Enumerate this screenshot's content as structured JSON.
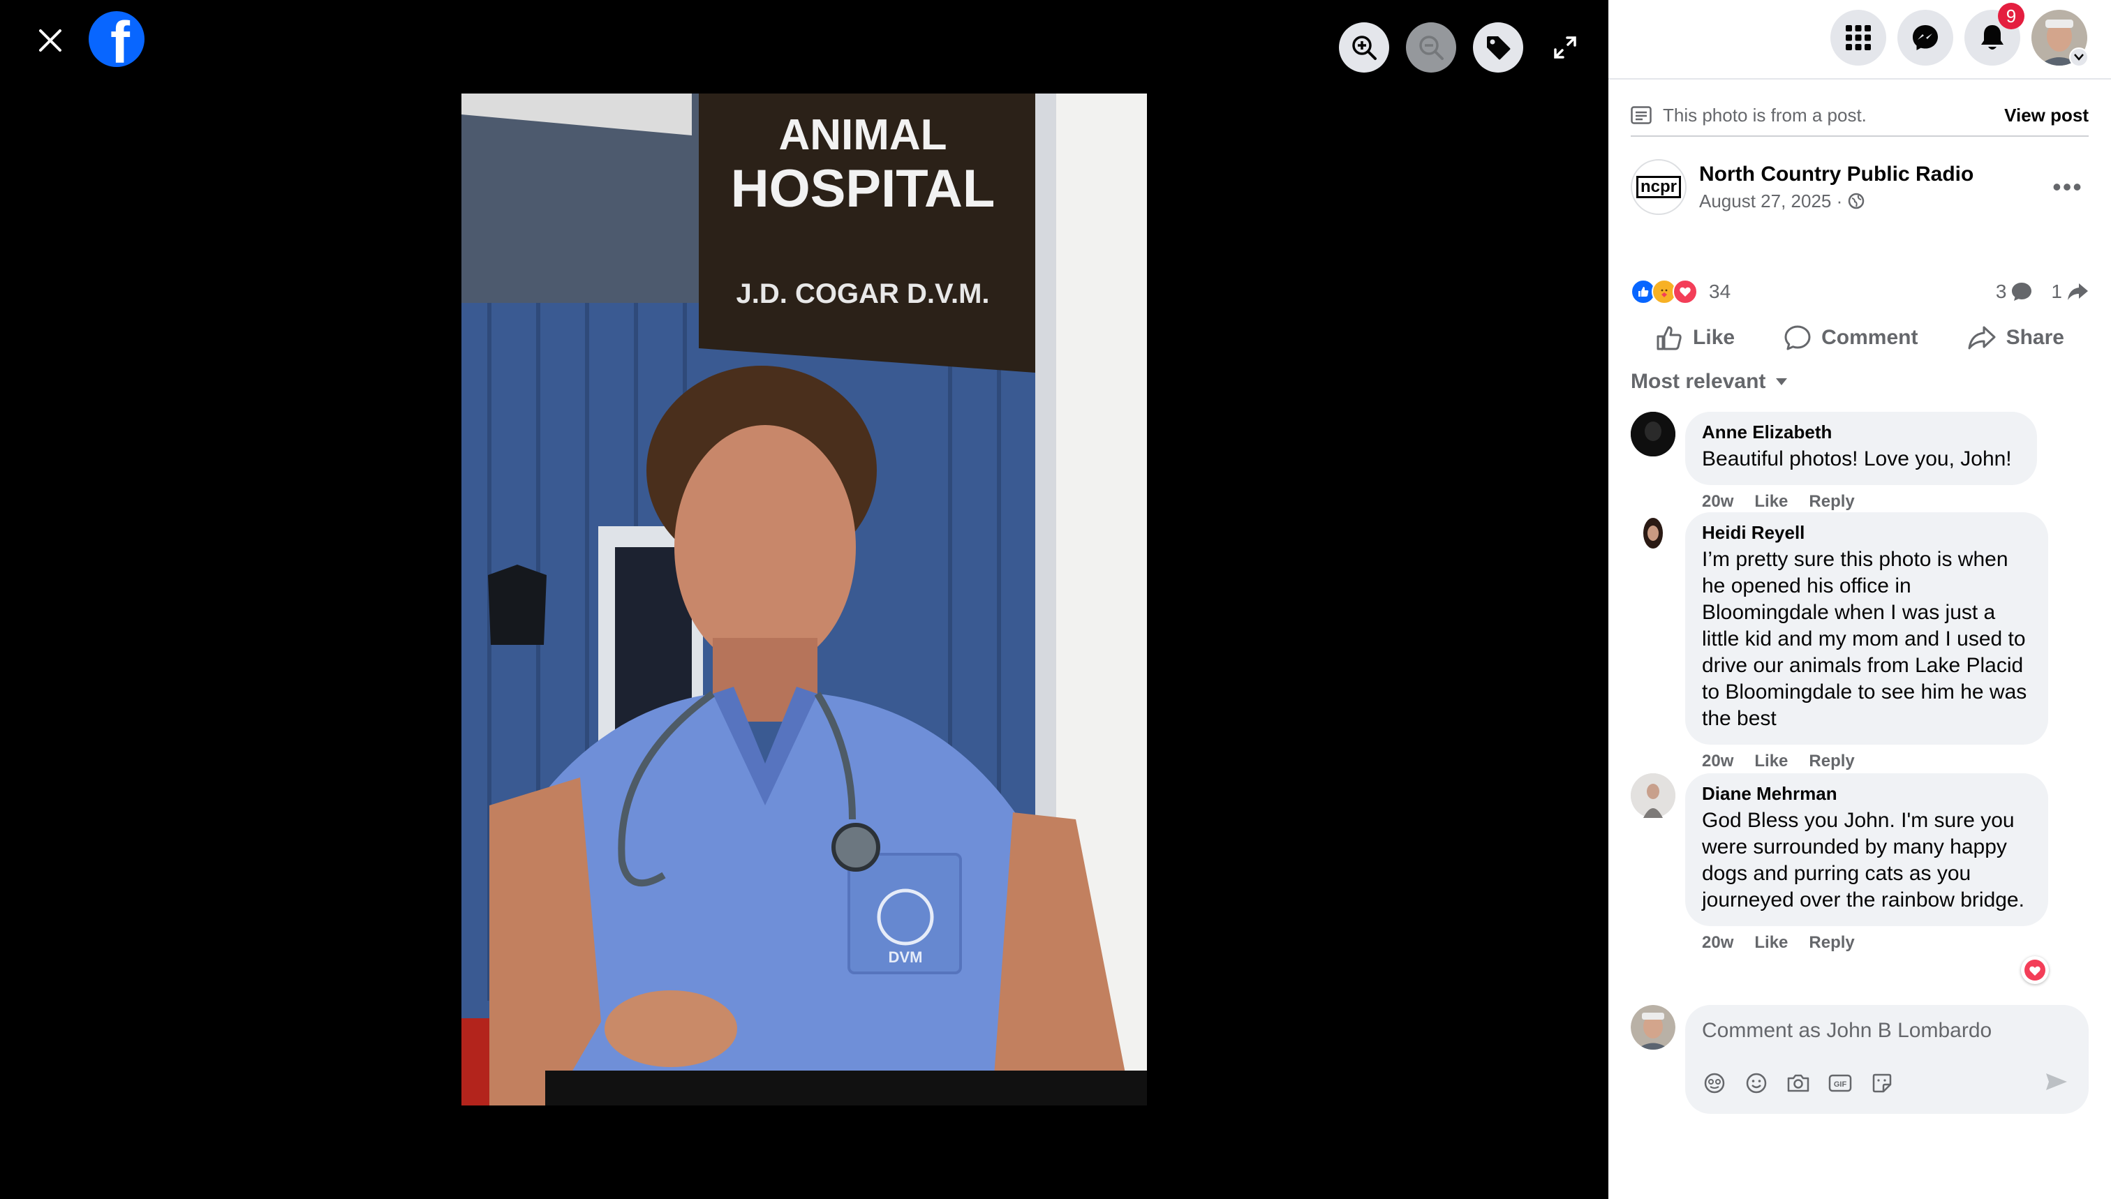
{
  "viewer": {
    "close_icon": "close-icon",
    "logo_letter": "f",
    "tools": [
      "zoom-in-icon",
      "zoom-out-icon",
      "tag-icon",
      "fullscreen-icon"
    ]
  },
  "photo": {
    "sign_line1": "ANIMAL",
    "sign_line2": "HOSPITAL",
    "sign_line3": "J.D. COGAR  D.V.M.",
    "pocket_text": "DVM"
  },
  "header": {
    "notification_count": "9",
    "icons": [
      "menu-grid-icon",
      "messenger-icon",
      "bell-icon",
      "account-avatar"
    ]
  },
  "post": {
    "from_post_text": "This photo is from a post.",
    "view_post_label": "View post",
    "page_logo": "ncpr",
    "page_name": "North Country Public Radio",
    "date": "August 27, 2025 ·",
    "more": "•••",
    "reaction_count": "34",
    "comment_count": "3",
    "share_count": "1",
    "like_label": "Like",
    "comment_label": "Comment",
    "share_label": "Share",
    "sort_label": "Most relevant"
  },
  "comments": [
    {
      "name": "Anne Elizabeth",
      "text": "Beautiful photos! Love you, John!",
      "time": "20w",
      "like": "Like",
      "reply": "Reply"
    },
    {
      "name": "Heidi Reyell",
      "text": "I’m pretty sure this photo is when he opened his office in Bloomingdale when I was just a little kid and my mom and I used to drive our animals from Lake Placid to Bloomingdale to see him he was the best",
      "time": "20w",
      "like": "Like",
      "reply": "Reply"
    },
    {
      "name": "Diane Mehrman",
      "text": "God Bless you John. I'm sure you were surrounded by many happy dogs and purring cats as you journeyed over the rainbow bridge.",
      "time": "20w",
      "like": "Like",
      "reply": "Reply"
    }
  ],
  "composer": {
    "placeholder": "Comment as John B Lombardo"
  },
  "colors": {
    "brand": "#0866ff",
    "badge": "#e41e3f",
    "scrubs": "#6f8fd8"
  }
}
